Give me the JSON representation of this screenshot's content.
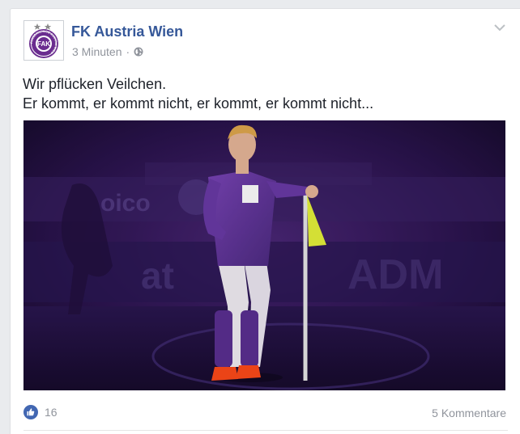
{
  "post": {
    "page_name": "FK Austria Wien",
    "timestamp": "3 Minuten",
    "separator": "·",
    "audience_icon": "globe-icon",
    "menu_icon": "chevron-down-icon",
    "text_line1": "Wir pflücken Veilchen.",
    "text_line2": "Er kommt, er kommt nicht, er kommt, er kommt nicht...",
    "photo": {
      "subject": "football player in purple kit posing at corner flag",
      "sponsor_texts": [
        "oico",
        "at",
        "ADM"
      ]
    },
    "avatar": {
      "logo_text": "FAK",
      "ring_text": "FUSSBALLKLUB AUSTRIA WIEN"
    }
  },
  "footer": {
    "like_icon": "thumbs-up-icon",
    "likes_count": "16",
    "comments_label": "5 Kommentare"
  },
  "colors": {
    "brand_purple": "#6a2c8f",
    "link_blue": "#365899",
    "like_blue": "#4267b2",
    "muted_gray": "#90949c"
  }
}
